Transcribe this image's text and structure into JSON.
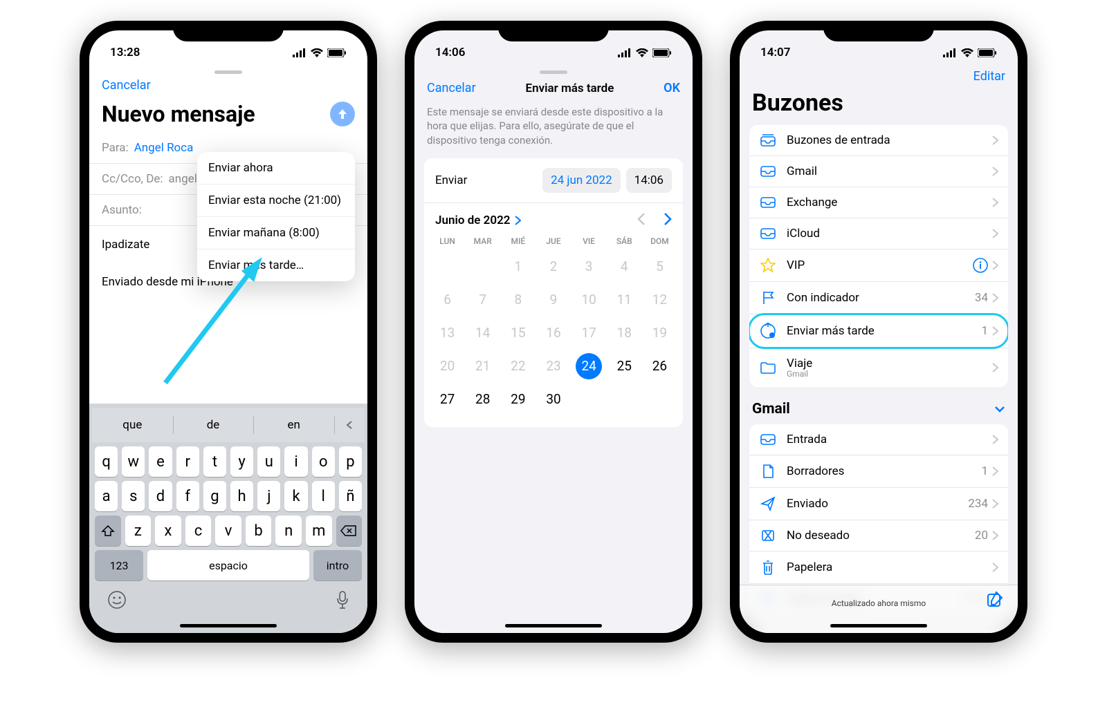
{
  "p1": {
    "status_time": "13:28",
    "cancel": "Cancelar",
    "title": "Nuevo mensaje",
    "to_label": "Para:",
    "to_value": "Angel Roca",
    "cc_label": "Cc/Cco, De:",
    "cc_value": "angelroca",
    "subject_label": "Asunto:",
    "body_line1": "Ipadizate",
    "body_line2": "Enviado desde mi iPhone",
    "popup": {
      "now": "Enviar ahora",
      "tonight": "Enviar esta noche (21:00)",
      "tomorrow": "Enviar mañana (8:00)",
      "later": "Enviar más tarde…"
    },
    "kb": {
      "suggest1": "que",
      "suggest2": "de",
      "suggest3": "en",
      "row1": [
        "q",
        "w",
        "e",
        "r",
        "t",
        "y",
        "u",
        "i",
        "o",
        "p"
      ],
      "row2": [
        "a",
        "s",
        "d",
        "f",
        "g",
        "h",
        "j",
        "k",
        "l",
        "ñ"
      ],
      "row3": [
        "z",
        "x",
        "c",
        "v",
        "b",
        "n",
        "m"
      ],
      "num": "123",
      "space": "espacio",
      "enter": "intro"
    }
  },
  "p2": {
    "status_time": "14:06",
    "cancel": "Cancelar",
    "title": "Enviar más tarde",
    "ok": "OK",
    "desc": "Este mensaje se enviará desde este dispositivo a la hora que elijas. Para ello, asegúrate de que el dispositivo tenga conexión.",
    "send_label": "Enviar",
    "send_date": "24 jun 2022",
    "send_time": "14:06",
    "month": "Junio de 2022",
    "daynames": [
      "LUN",
      "MAR",
      "MIÉ",
      "JUE",
      "VIE",
      "SÁB",
      "DOM"
    ],
    "weeks": [
      [
        "",
        "",
        "1",
        "2",
        "3",
        "4",
        "5"
      ],
      [
        "6",
        "7",
        "8",
        "9",
        "10",
        "11",
        "12"
      ],
      [
        "13",
        "14",
        "15",
        "16",
        "17",
        "18",
        "19"
      ],
      [
        "20",
        "21",
        "22",
        "23",
        "24",
        "25",
        "26"
      ],
      [
        "27",
        "28",
        "29",
        "30",
        "",
        "",
        ""
      ]
    ],
    "selected_day": "24"
  },
  "p3": {
    "status_time": "14:07",
    "edit": "Editar",
    "title": "Buzones",
    "mailboxes": [
      {
        "icon": "inbox-all",
        "label": "Buzones de entrada",
        "count": ""
      },
      {
        "icon": "inbox",
        "label": "Gmail",
        "count": ""
      },
      {
        "icon": "inbox",
        "label": "Exchange",
        "count": ""
      },
      {
        "icon": "inbox",
        "label": "iCloud",
        "count": ""
      },
      {
        "icon": "star",
        "label": "VIP",
        "count": "",
        "info": true
      },
      {
        "icon": "flag",
        "label": "Con indicador",
        "count": "34"
      },
      {
        "icon": "clock-send",
        "label": "Enviar más tarde",
        "count": "1",
        "highlight": true
      },
      {
        "icon": "folder",
        "label": "Viaje",
        "sublabel": "Gmail",
        "count": ""
      }
    ],
    "section2_title": "Gmail",
    "gmail": [
      {
        "icon": "inbox",
        "label": "Entrada",
        "count": ""
      },
      {
        "icon": "doc",
        "label": "Borradores",
        "count": "1"
      },
      {
        "icon": "send",
        "label": "Enviado",
        "count": "234"
      },
      {
        "icon": "junk",
        "label": "No deseado",
        "count": "20"
      },
      {
        "icon": "trash",
        "label": "Papelera",
        "count": ""
      },
      {
        "icon": "archive",
        "label": "Todo el correo",
        "count": "2440"
      }
    ],
    "toolbar_status": "Actualizado ahora mismo"
  }
}
